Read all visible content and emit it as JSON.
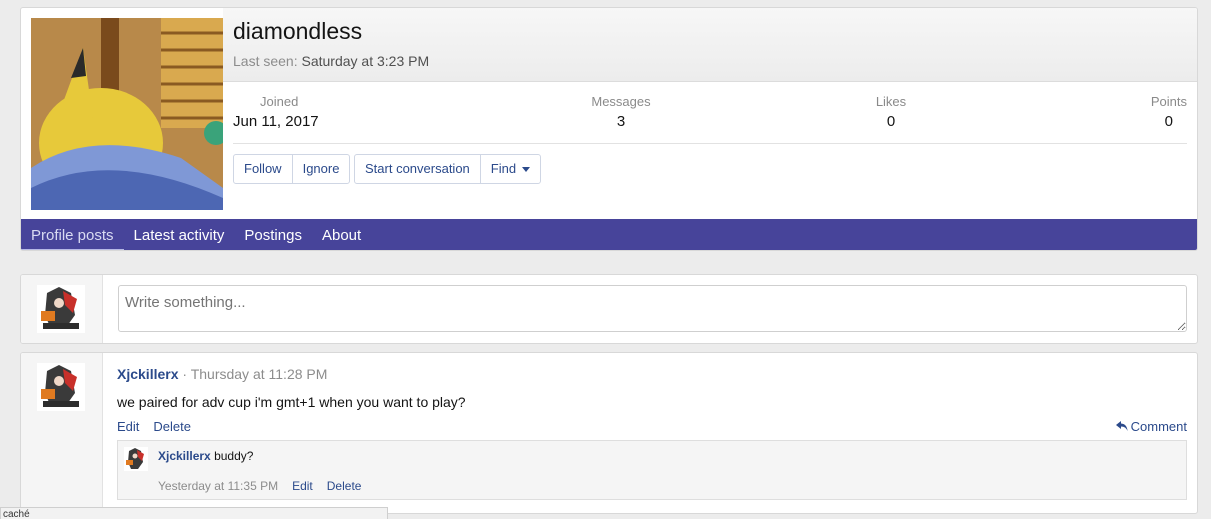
{
  "profile": {
    "username": "diamondless",
    "last_seen_label": "Last seen:",
    "last_seen_value": "Saturday at 3:23 PM",
    "stats": [
      {
        "label": "Joined",
        "value": "Jun 11, 2017"
      },
      {
        "label": "Messages",
        "value": "3"
      },
      {
        "label": "Likes",
        "value": "0"
      },
      {
        "label": "Points",
        "value": "0"
      }
    ],
    "buttons": {
      "follow": "Follow",
      "ignore": "Ignore",
      "start_conversation": "Start conversation",
      "find": "Find"
    }
  },
  "tabs": [
    {
      "label": "Profile posts",
      "active": true
    },
    {
      "label": "Latest activity",
      "active": false
    },
    {
      "label": "Postings",
      "active": false
    },
    {
      "label": "About",
      "active": false
    }
  ],
  "composer": {
    "placeholder": "Write something..."
  },
  "post": {
    "author": "Xjckillerx",
    "separator": "·",
    "time": "Thursday at 11:28 PM",
    "body": "we paired for adv cup i'm gmt+1 when you want to play?",
    "edit": "Edit",
    "delete": "Delete",
    "comment": "Comment",
    "reply": {
      "author": "Xjckillerx",
      "text": "buddy?",
      "time": "Yesterday at 11:35 PM",
      "edit": "Edit",
      "delete": "Delete"
    }
  },
  "status_bar": {
    "text": "caché"
  },
  "colors": {
    "tabbar": "#47449a",
    "link": "#2b4a8b"
  },
  "icons": {
    "find_dropdown": "caret-down-icon",
    "comment": "reply-arrow-icon"
  }
}
